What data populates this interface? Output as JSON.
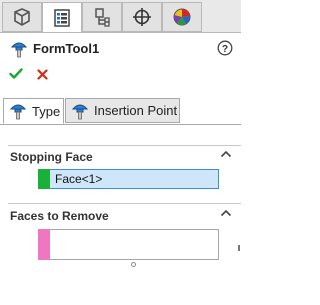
{
  "top_tabs": [
    {
      "icon": "feature-manager-icon"
    },
    {
      "icon": "property-manager-icon"
    },
    {
      "icon": "configuration-manager-icon"
    },
    {
      "icon": "dimxpert-icon"
    },
    {
      "icon": "display-manager-icon"
    }
  ],
  "header": {
    "feature_name": "FormTool1",
    "help_symbol": "?"
  },
  "actions": {
    "ok_symbol": "✔",
    "cancel_symbol": "✖"
  },
  "tabs": [
    {
      "label": "Type",
      "active": true
    },
    {
      "label": "Insertion Point",
      "active": false
    }
  ],
  "stopping_face": {
    "title": "Stopping Face",
    "selection": "Face<1>",
    "color": "#18b23a"
  },
  "faces_to_remove": {
    "title": "Faces to Remove",
    "color": "#ef77c0"
  },
  "colors": {
    "ok": "#17a83a",
    "cancel": "#d62a17",
    "selection_highlight": "#cfe5f8"
  }
}
